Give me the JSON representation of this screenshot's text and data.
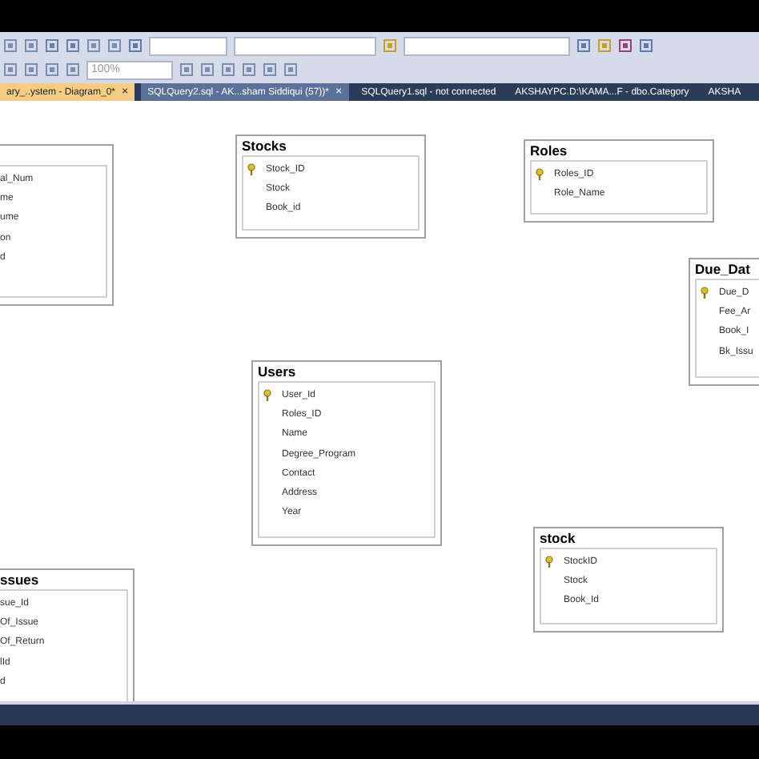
{
  "toolbar": {
    "zoom": "100%"
  },
  "tabs": [
    {
      "label": "ary_..ystem - Diagram_0*",
      "selected": true,
      "closable": true
    },
    {
      "label": "SQLQuery2.sql - AK...sham Siddiqui (57))*",
      "selected": false,
      "closable": true
    },
    {
      "label": "SQLQuery1.sql - not connected",
      "selected": false,
      "closable": false
    },
    {
      "label": "AKSHAYPC.D:\\KAMA...F - dbo.Category",
      "selected": false,
      "closable": false
    },
    {
      "label": "AKSHA",
      "selected": false,
      "closable": false
    }
  ],
  "close_glyph": "×",
  "tables": [
    {
      "columns": [
        {
          "name": "al_Num"
        },
        {
          "name": "me"
        },
        {
          "name": "ume"
        },
        {
          "name": "on"
        },
        {
          "name": "d"
        }
      ]
    },
    {
      "title": "Stocks",
      "columns": [
        {
          "name": "Stock_ID",
          "key": true
        },
        {
          "name": "Stock",
          "key": false
        },
        {
          "name": "Book_id",
          "key": false
        }
      ]
    },
    {
      "title": "Roles",
      "columns": [
        {
          "name": "Roles_ID",
          "key": true
        },
        {
          "name": "Role_Name",
          "key": false
        }
      ]
    },
    {
      "title": "Due_Dat",
      "columns": [
        {
          "name": "Due_D",
          "key": true
        },
        {
          "name": "Fee_Ar",
          "key": false
        },
        {
          "name": "Book_I",
          "key": false
        },
        {
          "name": "Bk_Issu",
          "key": false
        }
      ]
    },
    {
      "title": "Users",
      "columns": [
        {
          "name": "User_Id",
          "key": true
        },
        {
          "name": "Roles_ID",
          "key": false
        },
        {
          "name": "Name",
          "key": false
        },
        {
          "name": "Degree_Program",
          "key": false
        },
        {
          "name": "Contact",
          "key": false
        },
        {
          "name": "Address",
          "key": false
        },
        {
          "name": "Year",
          "key": false
        }
      ]
    },
    {
      "title": "stock",
      "columns": [
        {
          "name": "StockID",
          "key": true
        },
        {
          "name": "Stock",
          "key": false
        },
        {
          "name": "Book_Id",
          "key": false
        }
      ]
    },
    {
      "title": "ssues",
      "columns": [
        {
          "name": "sue_Id"
        },
        {
          "name": "Of_Issue"
        },
        {
          "name": "Of_Return"
        },
        {
          "name": "lId"
        },
        {
          "name": "d"
        }
      ]
    }
  ]
}
